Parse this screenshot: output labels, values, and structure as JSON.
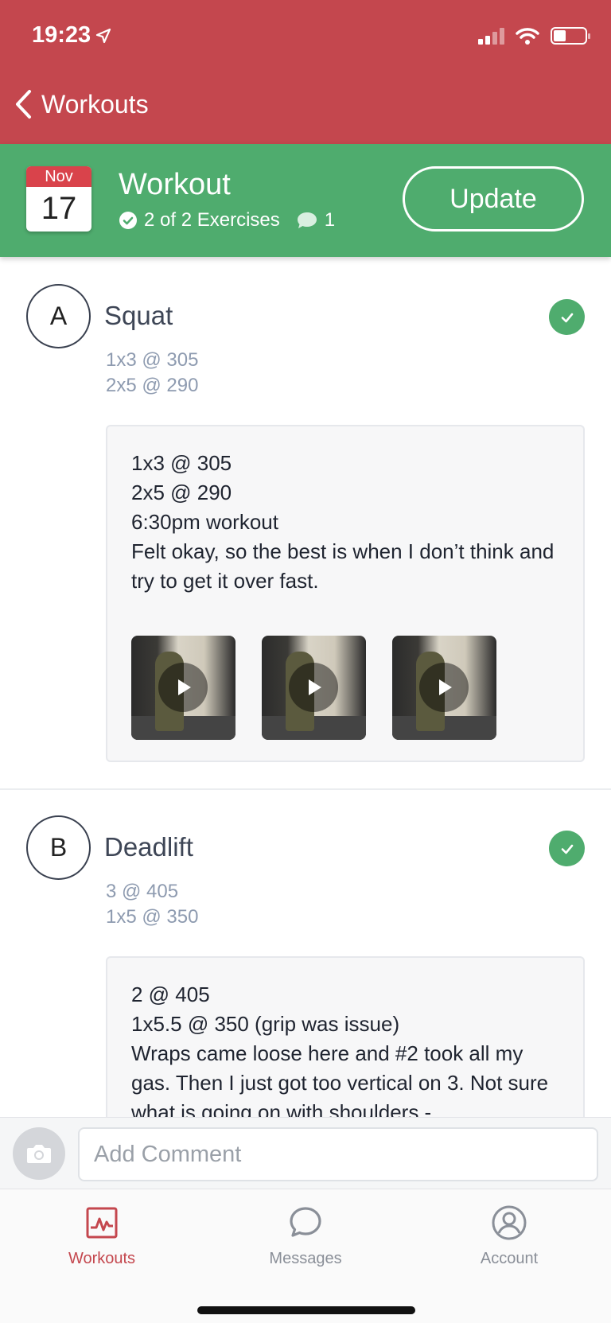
{
  "status": {
    "time": "19:23"
  },
  "nav": {
    "back_label": "Workouts"
  },
  "workout": {
    "month": "Nov",
    "day": "17",
    "title": "Workout",
    "exercises_done": "2 of 2 Exercises",
    "comments_count": "1",
    "update_label": "Update"
  },
  "exercises": [
    {
      "letter": "A",
      "name": "Squat",
      "sets": [
        "1x3 @ 305",
        "2x5 @ 290"
      ],
      "note_lines": [
        "1x3 @ 305",
        "2x5 @ 290",
        "6:30pm workout",
        "Felt okay, so the best is when I don’t think and try to get it over fast."
      ],
      "videos": 3,
      "completed": true
    },
    {
      "letter": "B",
      "name": "Deadlift",
      "sets": [
        "3 @ 405",
        "1x5 @ 350"
      ],
      "note_lines": [
        "2 @ 405",
        "1x5.5 @ 350 (grip was issue)",
        "Wraps came loose here and #2 took all my gas. Then I just got too vertical on 3. Not sure what is going on with shoulders -"
      ],
      "completed": true
    }
  ],
  "comment": {
    "placeholder": "Add Comment"
  },
  "tabs": [
    {
      "label": "Workouts",
      "icon": "chart-icon",
      "active": true
    },
    {
      "label": "Messages",
      "icon": "chat-bubble-icon",
      "active": false
    },
    {
      "label": "Account",
      "icon": "person-circle-icon",
      "active": false
    }
  ],
  "colors": {
    "header_red": "#c4474e",
    "accent_green": "#4fac6e",
    "calendar_red": "#d9434b"
  }
}
